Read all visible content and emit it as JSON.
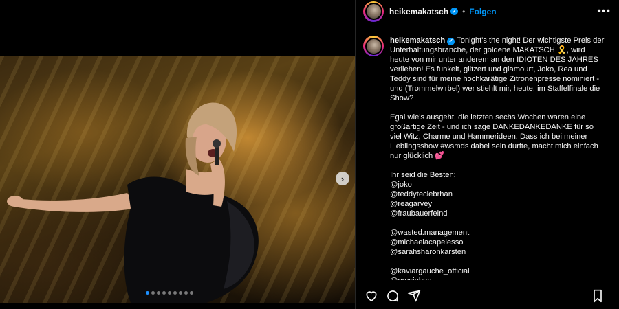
{
  "post": {
    "username": "heikemakatsch",
    "follow_label": "Folgen",
    "separator": "•",
    "verified_mark": "✓",
    "more_label": "•••"
  },
  "caption": {
    "username": "heikemakatsch",
    "para1": "Tonight's the night! Der wichtigste Preis der Unterhaltungsbranche, der goldene MAKATSCH 🎗️, wird heute von mir unter anderem an den IDIOTEN DES JAHRES verliehen! Es funkelt, glitzert und glamourt, Joko, Rea und Teddy sind für meine hochkarätige Zitronenpresse nominiert - und (Trommelwirbel) wer stiehlt mir, heute, im Staffelfinale die Show?",
    "para2": "Egal wie's ausgeht, die letzten sechs Wochen waren eine großartige Zeit - und ich sage DANKEDANKEDANKE für so viel Witz, Charme und Hammerideen. Dass ich bei meiner Lieblingsshow #wsmds dabei sein durfte, macht mich einfach nur glücklich 💕",
    "para3_heading": "Ihr seid die Besten:",
    "mentions_group1": [
      "@joko",
      "@teddyteclebrhan",
      "@reagarvey",
      "@fraubauerfeind"
    ],
    "mentions_group2": [
      "@wasted.management",
      "@michaelacapelesso",
      "@sarahsharonkarsten"
    ],
    "mentions_group3": [
      "@kaviargauche_official",
      "@prosieben"
    ]
  },
  "carousel": {
    "next_arrow": "›",
    "dot_count": 9,
    "active_index": 0
  },
  "icons": {
    "header_more": "more-horizontal-icon",
    "like": "heart-icon",
    "comment": "comment-icon",
    "share": "share-icon",
    "save": "bookmark-icon",
    "next": "chevron-right-icon"
  },
  "colors": {
    "accent": "#0095f6",
    "background": "#000000",
    "text": "#f5f5f5",
    "divider": "#262626",
    "dot_active": "#1e90ff"
  }
}
